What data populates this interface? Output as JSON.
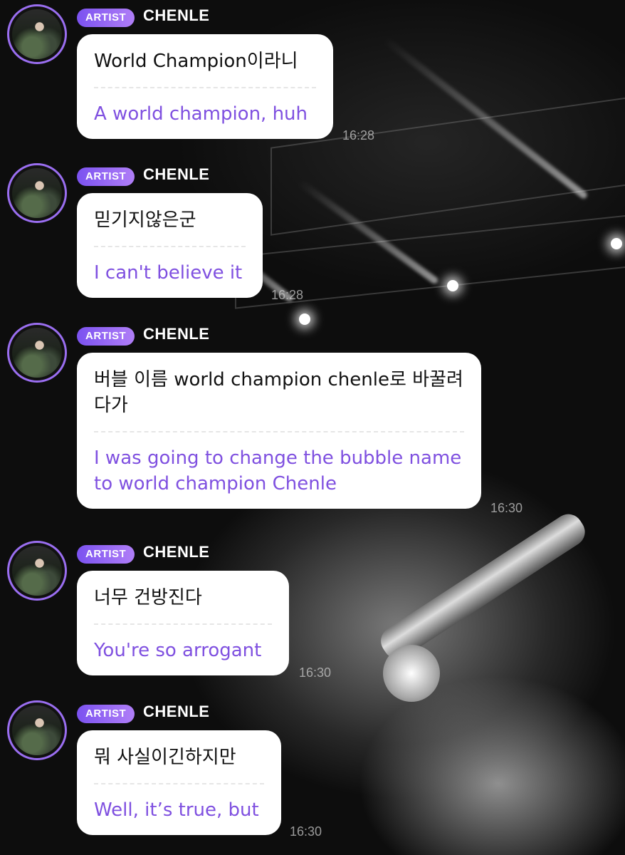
{
  "badge_label": "ARTIST",
  "colors": {
    "badge_start": "#7b52f0",
    "badge_end": "#b07ef7",
    "translation_text": "#7f50e0",
    "avatar_ring": "#9a6ef0"
  },
  "messages": [
    {
      "sender": "CHENLE",
      "original": "World Champion이라니",
      "translation": "A world champion, huh",
      "time": "16:28"
    },
    {
      "sender": "CHENLE",
      "original": "믿기지않은군",
      "translation": "I can't believe it",
      "time": "16:28"
    },
    {
      "sender": "CHENLE",
      "original": "버블 이름 world champion chenle로 바꿀려다가",
      "translation": "I was going to change the bubble name to world champion Chenle",
      "time": "16:30"
    },
    {
      "sender": "CHENLE",
      "original": "너무 건방진다",
      "translation": "You're so arrogant",
      "time": "16:30"
    },
    {
      "sender": "CHENLE",
      "original": "뭐 사실이긴하지만",
      "translation": "Well, it’s true, but",
      "time": "16:30"
    }
  ]
}
